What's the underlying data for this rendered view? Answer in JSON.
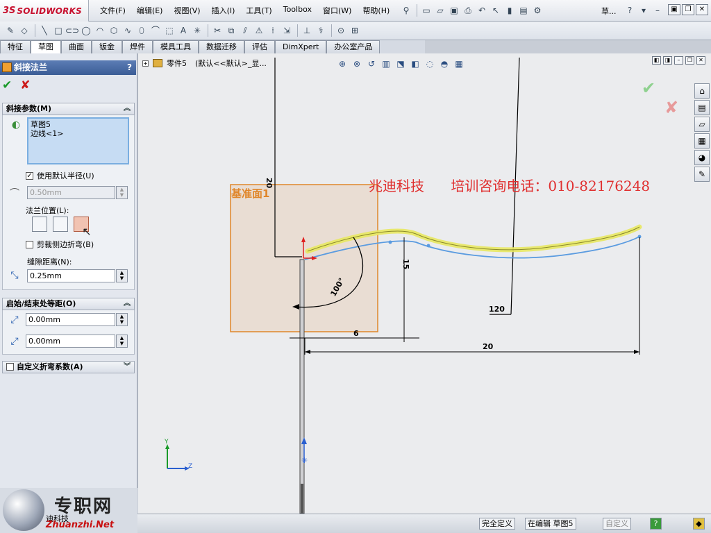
{
  "app": {
    "logo_ds": "3S",
    "logo_name": "SOLIDWORKS",
    "title": "草...",
    "menus": [
      "文件(F)",
      "编辑(E)",
      "视图(V)",
      "插入(I)",
      "工具(T)",
      "Toolbox",
      "窗口(W)",
      "帮助(H)"
    ]
  },
  "tabs": [
    "特征",
    "草图",
    "曲面",
    "钣金",
    "焊件",
    "模具工具",
    "数据迁移",
    "评估",
    "DimXpert",
    "办公室产品"
  ],
  "active_tab": "草图",
  "property_manager": {
    "title": "斜接法兰",
    "help": "?",
    "ok": "✔",
    "cancel": "✘",
    "miter_params": {
      "header": "斜接参数(M)",
      "selections": [
        "草图5",
        "边线<1>"
      ],
      "use_default_radius_label": "使用默认半径(U)",
      "use_default_radius_checked": true,
      "radius_value": "0.50mm",
      "flange_position_label": "法兰位置(L):",
      "trim_side_bends_label": "剪裁侧边折弯(B)",
      "trim_side_bends_checked": false,
      "gap_distance_label": "缝隙距离(N):",
      "gap_distance_value": "0.25mm"
    },
    "offset": {
      "header": "启始/结束处等距(O)",
      "d1_value": "0.00mm",
      "d2_value": "0.00mm"
    },
    "custom_bend": {
      "header": "自定义折弯系数(A)",
      "checked": false
    }
  },
  "graphics": {
    "feature_tree_item": "零件5",
    "feature_tree_config": "(默认<<默认>_显...",
    "plane_label": "基准面1",
    "watermark_company": "兆迪科技",
    "watermark_phone": "培训咨询电话：010-82176248",
    "dimensions": {
      "d_top": "20",
      "d_15": "15",
      "d_angle": "100°",
      "d_6": "6",
      "d_120": "120",
      "d_20": "20"
    },
    "axes": {
      "y": "Y",
      "z": "Z"
    }
  },
  "branding": {
    "cn": "专职网",
    "sub": "迪科技",
    "url": "Zhuanzhi.Net"
  },
  "status": {
    "fully_defined": "完全定义",
    "editing": "在编辑 草图5",
    "custom": "自定义"
  },
  "colors": {
    "plane": "#e0862a",
    "highlight": "#e8e860",
    "sketch_blue": "#5a9be0",
    "watermark": "#e03030"
  }
}
